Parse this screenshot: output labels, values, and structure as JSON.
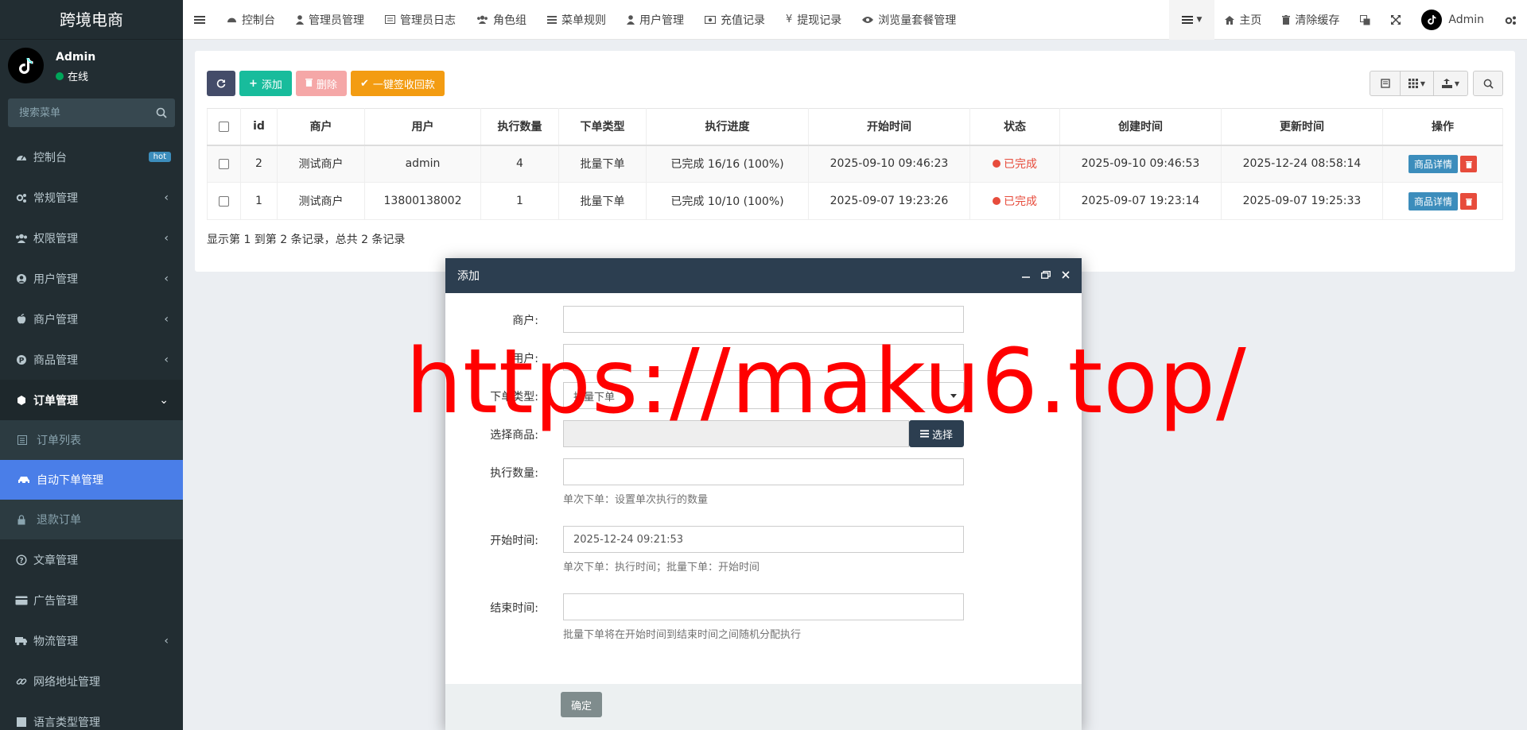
{
  "app": {
    "title": "跨境电商",
    "user": {
      "name": "Admin",
      "status": "在线"
    },
    "search_placeholder": "搜索菜单"
  },
  "sidebar": {
    "items": [
      {
        "label": "控制台",
        "badge": "hot"
      },
      {
        "label": "常规管理"
      },
      {
        "label": "权限管理"
      },
      {
        "label": "用户管理"
      },
      {
        "label": "商户管理"
      },
      {
        "label": "商品管理"
      },
      {
        "label": "订单管理"
      },
      {
        "label": "文章管理"
      },
      {
        "label": "广告管理"
      },
      {
        "label": "物流管理"
      },
      {
        "label": "网络地址管理"
      },
      {
        "label": "语言类型管理"
      }
    ],
    "subitems": [
      {
        "label": "订单列表"
      },
      {
        "label": "自动下单管理"
      },
      {
        "label": "退款订单"
      }
    ]
  },
  "topnav": {
    "items": [
      "控制台",
      "管理员管理",
      "管理员日志",
      "角色组",
      "菜单规则",
      "用户管理",
      "充值记录",
      "提现记录",
      "浏览量套餐管理"
    ],
    "home": "主页",
    "clear_cache": "清除缓存",
    "admin": "Admin"
  },
  "toolbar": {
    "add": "添加",
    "delete": "删除",
    "collect": "一键签收回款"
  },
  "table": {
    "headers": [
      "id",
      "商户",
      "用户",
      "执行数量",
      "下单类型",
      "执行进度",
      "开始时间",
      "状态",
      "创建时间",
      "更新时间",
      "操作"
    ],
    "rows": [
      {
        "id": "2",
        "merchant": "测试商户",
        "user": "admin",
        "qty": "4",
        "type": "批量下单",
        "progress": "已完成 16/16 (100%)",
        "start": "2025-09-10 09:46:23",
        "status": "已完成",
        "created": "2025-09-10 09:46:53",
        "updated": "2025-12-24 08:58:14",
        "action": "商品详情"
      },
      {
        "id": "1",
        "merchant": "测试商户",
        "user": "13800138002",
        "qty": "1",
        "type": "批量下单",
        "progress": "已完成 10/10 (100%)",
        "start": "2025-09-07 19:23:26",
        "status": "已完成",
        "created": "2025-09-07 19:23:14",
        "updated": "2025-09-07 19:25:33",
        "action": "商品详情"
      }
    ],
    "footer": "显示第 1 到第 2 条记录，总共 2 条记录"
  },
  "modal": {
    "title": "添加",
    "fields": {
      "merchant_label": "商户:",
      "user_label": "用户:",
      "type_label": "下单类型:",
      "type_value": "批量下单",
      "product_label": "选择商品:",
      "choose_button": "选择",
      "qty_label": "执行数量:",
      "qty_help": "单次下单：设置单次执行的数量",
      "start_label": "开始时间:",
      "start_value": "2025-12-24 09:21:53",
      "start_help": "单次下单：执行时间；批量下单：开始时间",
      "end_label": "结束时间:",
      "end_help": "批量下单将在开始时间到结束时间之间随机分配执行"
    },
    "ok": "确定"
  },
  "watermark": "https://maku6.top/"
}
